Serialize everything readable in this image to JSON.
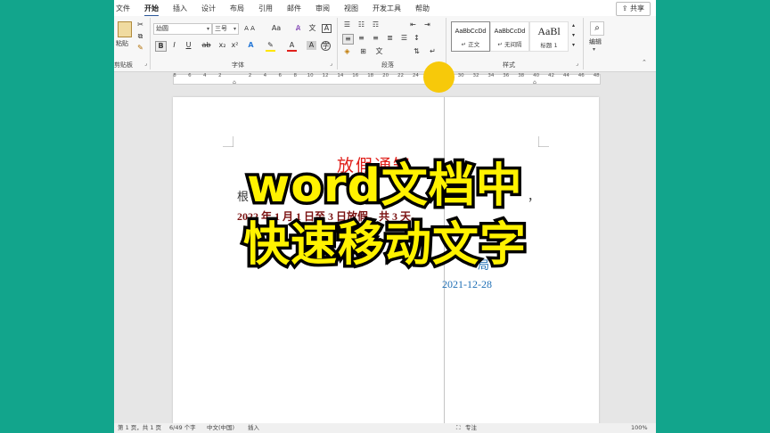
{
  "tabs": [
    "文件",
    "开始",
    "插入",
    "设计",
    "布局",
    "引用",
    "邮件",
    "审阅",
    "视图",
    "开发工具",
    "帮助"
  ],
  "share_label": "共享",
  "ribbon": {
    "clipboard": {
      "paste_label": "粘贴",
      "group_label": "剪贴板"
    },
    "font": {
      "font_name": "幼圆",
      "font_size": "三号",
      "grow_shrink": "A A",
      "case_label": "Aa",
      "bold": "B",
      "italic": "I",
      "underline": "U",
      "group_label": "字体"
    },
    "paragraph": {
      "group_label": "段落"
    },
    "styles": {
      "items": [
        {
          "preview": "AaBbCcDd",
          "name": "↵ 正文"
        },
        {
          "preview": "AaBbCcDd",
          "name": "↵ 无间隔"
        },
        {
          "preview": "AaBl",
          "name": "标题 1"
        }
      ],
      "group_label": "样式"
    },
    "editing": {
      "label": "编辑"
    }
  },
  "ruler_ticks": [
    "8",
    "6",
    "4",
    "2",
    "",
    "2",
    "4",
    "6",
    "8",
    "10",
    "12",
    "14",
    "16",
    "18",
    "20",
    "22",
    "24",
    "",
    "",
    "30",
    "32",
    "34",
    "36",
    "38",
    "40",
    "42",
    "44",
    "46",
    "48"
  ],
  "document": {
    "title": "放假通知",
    "line1_start": "根",
    "line1_end": "，",
    "line2": "2022 年 1 月 1 日至 3 日放假，共 3 天。",
    "signature_partial": "局",
    "date": "2021-12-28"
  },
  "status": {
    "page": "第 1 页，共 1 页",
    "words": "6/49 个字",
    "language": "中文(中国)",
    "mode": "插入",
    "focus": "专注",
    "zoom": "100%"
  },
  "overlay": {
    "line1": "word文档中",
    "line2": "快速移动文字"
  },
  "colors": {
    "background": "#12a58c",
    "title_red": "#e0201b",
    "body_dark_red": "#7a1010",
    "date_blue": "#1f6fb5",
    "overlay_yellow": "#fff200",
    "cursor_dot": "#f7c90a"
  }
}
